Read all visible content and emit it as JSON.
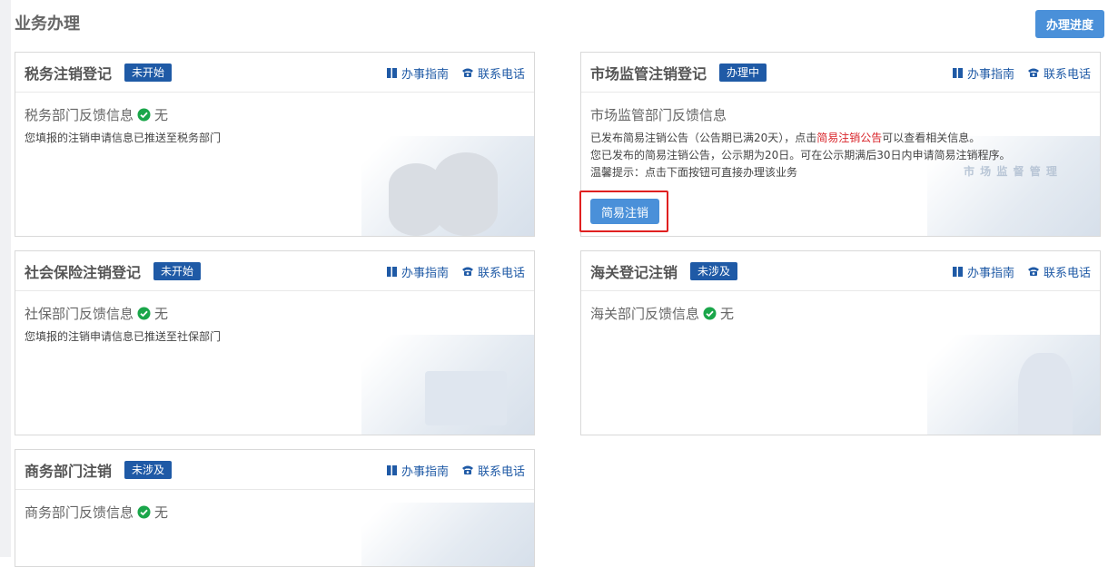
{
  "page": {
    "title": "业务办理",
    "progress_button": "办理进度"
  },
  "links": {
    "guide": "办事指南",
    "phone": "联系电话"
  },
  "colors": {
    "accent": "#1f5aa6",
    "button": "#4a90d9",
    "check": "#1aa64a",
    "highlight": "#d9252b"
  },
  "cards": {
    "tax": {
      "title": "税务注销登记",
      "status": "未开始",
      "feedback_label": "税务部门反馈信息",
      "feedback_value": "无",
      "message": "您填报的注销申请信息已推送至税务部门"
    },
    "market": {
      "title": "市场监管注销登记",
      "status": "办理中",
      "feedback_label": "市场监管部门反馈信息",
      "line1_pre": "已发布简易注销公告（公告期已满20天），点击",
      "line1_link": "简易注销公告",
      "line1_post": "可以查看相关信息。",
      "line2": "您已发布的简易注销公告，公示期为20日。可在公示期满后30日内申请简易注销程序。",
      "line3": "温馨提示：点击下面按钮可直接办理该业务",
      "action_button": "简易注销",
      "watermark": "市 场 监 督 管 理"
    },
    "social": {
      "title": "社会保险注销登记",
      "status": "未开始",
      "feedback_label": "社保部门反馈信息",
      "feedback_value": "无",
      "message": "您填报的注销申请信息已推送至社保部门"
    },
    "customs": {
      "title": "海关登记注销",
      "status": "未涉及",
      "feedback_label": "海关部门反馈信息",
      "feedback_value": "无"
    },
    "commerce": {
      "title": "商务部门注销",
      "status": "未涉及",
      "feedback_label": "商务部门反馈信息",
      "feedback_value": "无"
    }
  }
}
